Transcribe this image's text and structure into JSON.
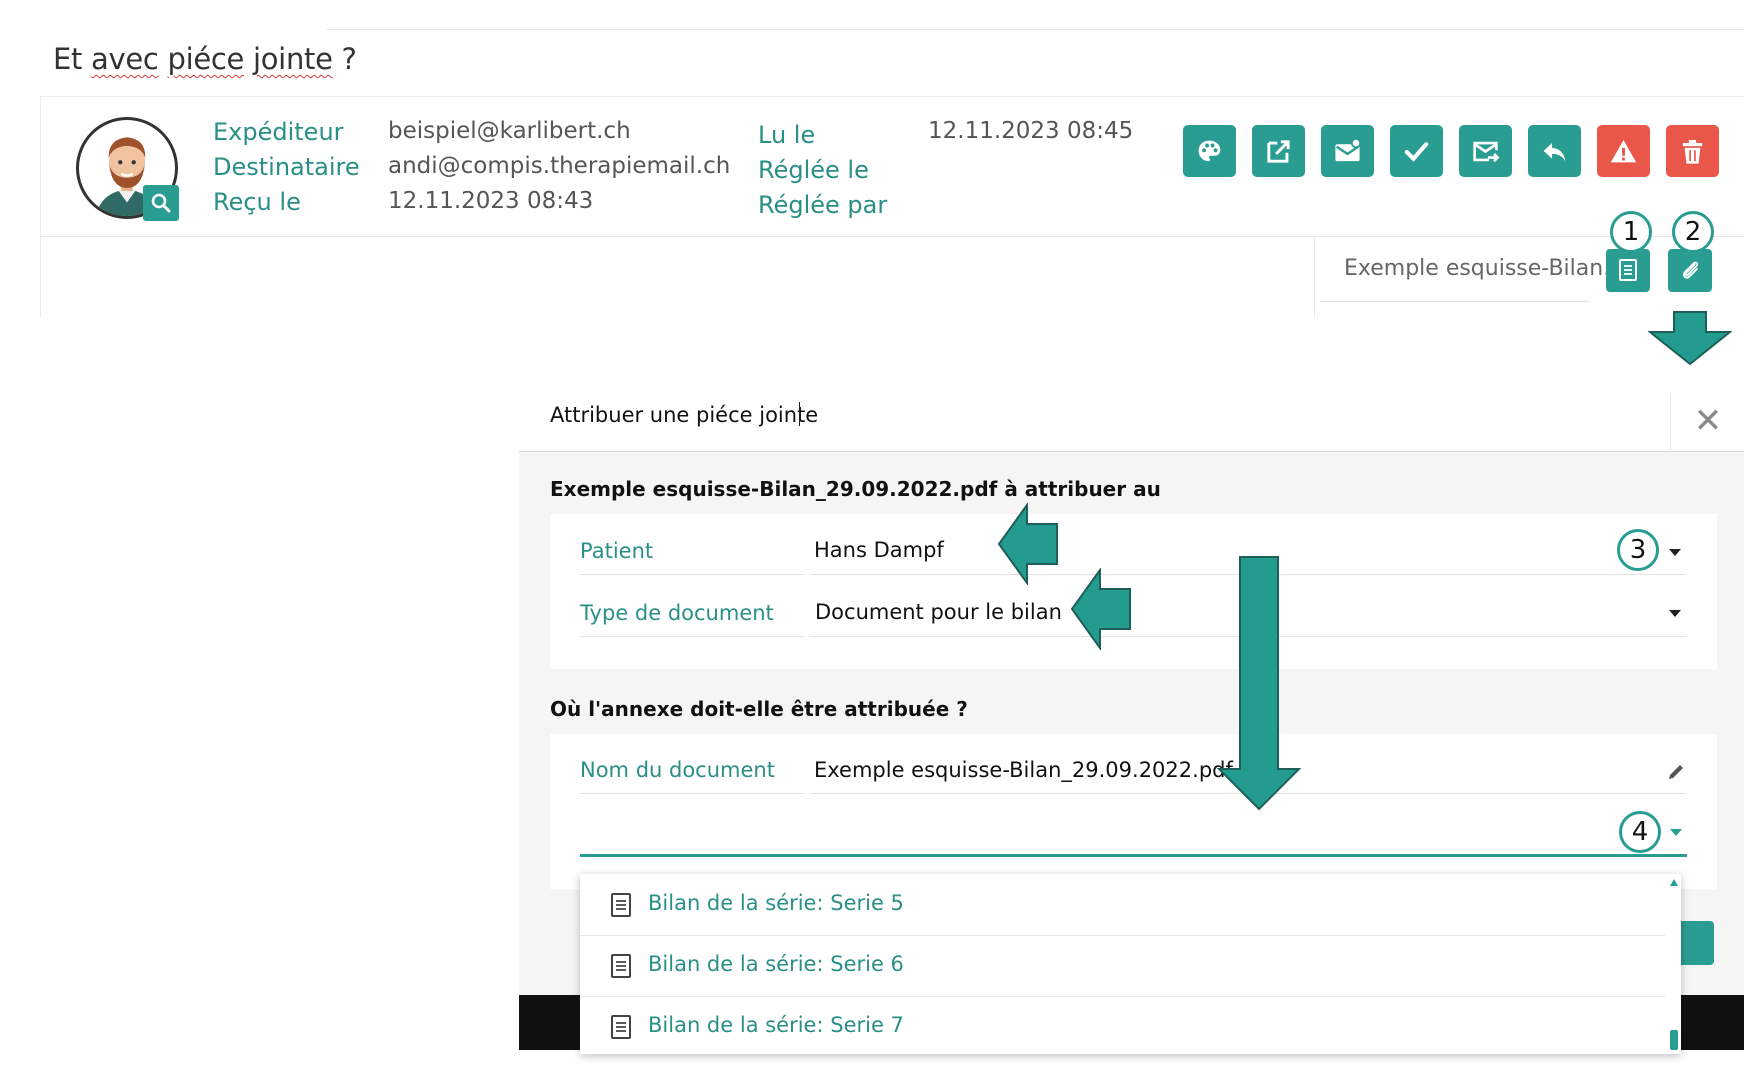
{
  "heading": {
    "prefix": "Et ",
    "word1": "avec",
    "space": " ",
    "word2": "piéce",
    "space2": " ",
    "word3": "jointe",
    "suffix": " ?"
  },
  "email": {
    "labels": {
      "sender": "Expéditeur",
      "recipient": "Destinataire",
      "received": "Reçu le",
      "read": "Lu le",
      "settled": "Réglée le",
      "settled_by": "Réglée par"
    },
    "values": {
      "sender": "beispiel@karlibert.ch",
      "recipient": "andi@compis.therapiemail.ch",
      "received": "12.11.2023 08:43",
      "read": "12.11.2023 08:45"
    }
  },
  "toolbar": [
    "palette-icon",
    "open-external-icon",
    "mark-unread-icon",
    "check-icon",
    "forward-mail-icon",
    "reply-icon",
    "warning-icon",
    "trash-icon"
  ],
  "attachment": {
    "name": "Exemple esquisse-Bilan..."
  },
  "callouts": {
    "c1": "1",
    "c2": "2",
    "c3": "3",
    "c4": "4"
  },
  "dialog": {
    "title": "Attribuer une piéce jointe",
    "section1": "Exemple esquisse-Bilan_29.09.2022.pdf à attribuer au",
    "patient_label": "Patient",
    "patient_value": "Hans Dampf",
    "doctype_label": "Type de document",
    "doctype_value": "Document pour le bilan",
    "section2": "Où l'annexe doit-elle être attribuée ?",
    "docname_label": "Nom du document",
    "docname_value": "Exemple esquisse-Bilan_29.09.2022.pdf",
    "dropdown_items": [
      "Bilan de la série: Serie 5",
      "Bilan de la série: Serie 6",
      "Bilan de la série: Serie 7"
    ]
  },
  "colors": {
    "accent": "#2a9d92",
    "danger": "#e9574a",
    "arrow": "#239b8f"
  }
}
